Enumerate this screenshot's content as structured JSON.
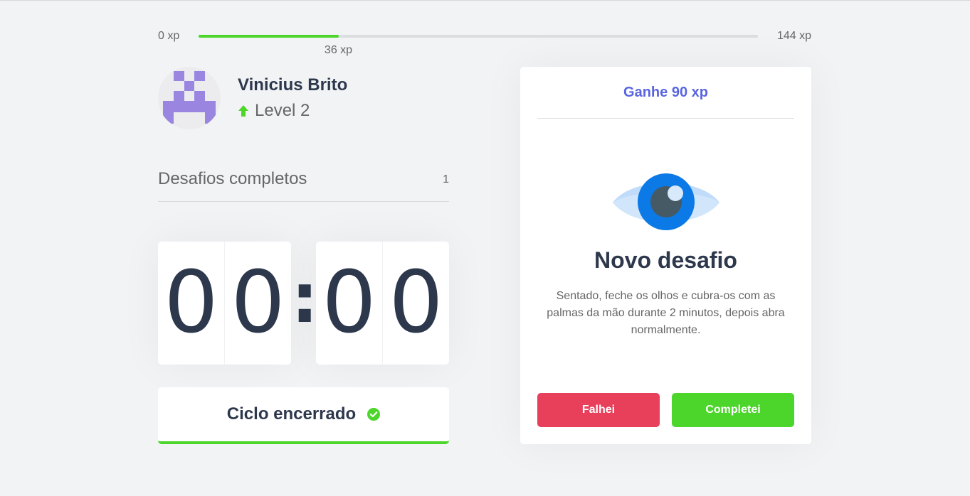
{
  "xp": {
    "min_label": "0 xp",
    "max_label": "144 xp",
    "current_label": "36 xp",
    "current": 36,
    "max": 144
  },
  "profile": {
    "name": "Vinicius Brito",
    "level_label": "Level 2",
    "level_icon": "level-up-arrow-icon",
    "avatar_icon": "space-invader-avatar"
  },
  "completed": {
    "label": "Desafios completos",
    "count": "1"
  },
  "countdown": {
    "minute_left": "0",
    "minute_right": "0",
    "separator": ":",
    "second_left": "0",
    "second_right": "0"
  },
  "cycle": {
    "label": "Ciclo encerrado",
    "icon": "check-circle-icon"
  },
  "challenge": {
    "reward": "Ganhe 90 xp",
    "icon": "eye-icon",
    "title": "Novo desafio",
    "description": "Sentado, feche os olhos e cubra-os com as palmas da mão durante 2 minutos, depois abra normalmente.",
    "fail_label": "Falhei",
    "success_label": "Completei"
  },
  "colors": {
    "background": "#f2f3f5",
    "text": "#666666",
    "title": "#2e384d",
    "green": "#4cd62b",
    "red": "#e83f5b",
    "blue": "#5965e0",
    "avatar_purple": "#9a86e0"
  }
}
